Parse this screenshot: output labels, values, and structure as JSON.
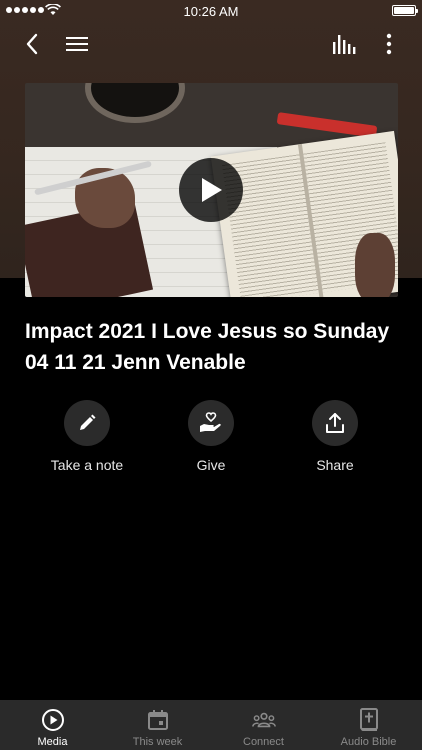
{
  "status_bar": {
    "time": "10:26 AM"
  },
  "nav": {
    "back_icon": "chevron-left-icon",
    "menu_icon": "hamburger-menu-icon",
    "audio_icon": "audio-levels-icon",
    "more_icon": "more-vertical-icon"
  },
  "video": {
    "play_icon": "play-icon"
  },
  "sermon": {
    "title": "Impact 2021 I Love Jesus so Sunday 04 11 21 Jenn Venable"
  },
  "actions": [
    {
      "label": "Take a note",
      "icon": "pencil-icon"
    },
    {
      "label": "Give",
      "icon": "hand-heart-icon"
    },
    {
      "label": "Share",
      "icon": "share-icon"
    }
  ],
  "tabs": [
    {
      "label": "Media",
      "icon": "play-circle-icon",
      "active": true
    },
    {
      "label": "This week",
      "icon": "calendar-icon",
      "active": false
    },
    {
      "label": "Connect",
      "icon": "people-icon",
      "active": false
    },
    {
      "label": "Audio Bible",
      "icon": "bible-icon",
      "active": false
    }
  ],
  "colors": {
    "background": "#000000",
    "header_bg": "#35271f",
    "tab_bar_bg": "#2a2a2a",
    "action_circle": "#2b2b2b",
    "tab_inactive": "#8a8a8a"
  }
}
